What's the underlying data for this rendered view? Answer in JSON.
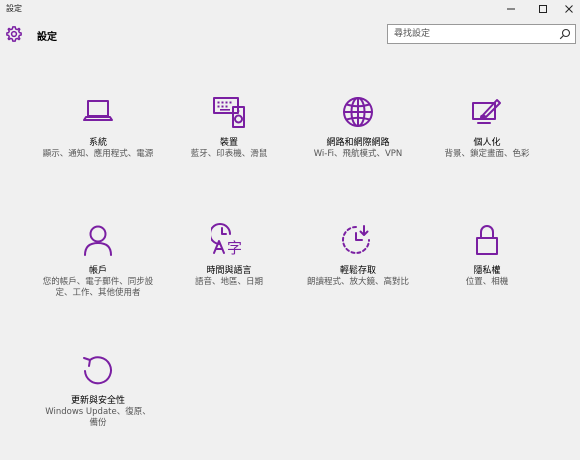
{
  "window": {
    "title": "設定"
  },
  "header": {
    "title": "設定",
    "search_placeholder": "尋找設定"
  },
  "tiles": [
    {
      "label": "系統",
      "desc": "顯示、通知、應用程式、電源",
      "icon": "laptop-icon"
    },
    {
      "label": "裝置",
      "desc": "藍牙、印表機、滑鼠",
      "icon": "keyboard-speaker-icon"
    },
    {
      "label": "網路和網際網路",
      "desc": "Wi-Fi、飛航模式、VPN",
      "icon": "globe-icon"
    },
    {
      "label": "個人化",
      "desc": "背景、鎖定畫面、色彩",
      "icon": "paint-display-icon"
    },
    {
      "label": "帳戶",
      "desc": "您的帳戶、電子郵件、同步設定、工作、其他使用者",
      "icon": "person-icon"
    },
    {
      "label": "時間與語言",
      "desc": "語音、地區、日期",
      "icon": "time-language-icon"
    },
    {
      "label": "輕鬆存取",
      "desc": "朗讀程式、放大鏡、高對比",
      "icon": "ease-of-access-icon"
    },
    {
      "label": "隱私權",
      "desc": "位置、相機",
      "icon": "lock-icon"
    },
    {
      "label": "更新與安全性",
      "desc": "Windows Update、復原、備份",
      "icon": "update-icon"
    }
  ],
  "colors": {
    "accent": "#7a1fa2",
    "background": "#f0f0f0"
  }
}
